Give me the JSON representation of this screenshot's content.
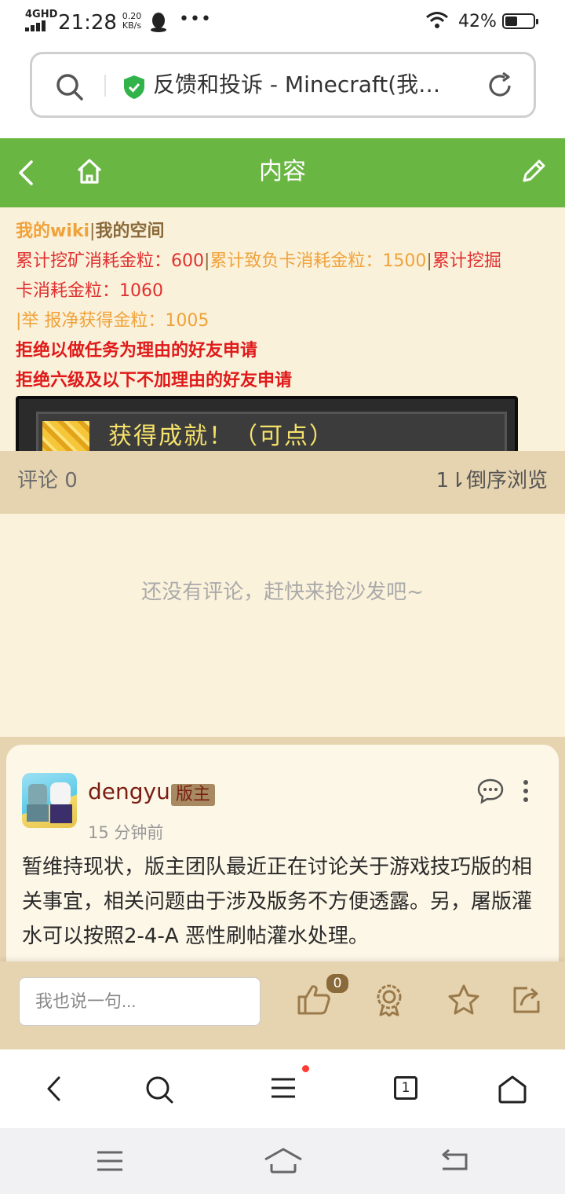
{
  "status_bar": {
    "network": "4GHD",
    "time": "21:28",
    "speed_value": "0.20",
    "speed_unit": "KB/s",
    "battery": "42%"
  },
  "url_bar": {
    "title": "反馈和投诉 - Minecraft(我…"
  },
  "header": {
    "title": "内容"
  },
  "content": {
    "line1_wiki": "我的wiki",
    "line1_sep": "|",
    "line1_space": "我的空间",
    "line2_a": "累计挖矿消耗金粒：600",
    "line2_sep1": "|",
    "line2_b": "累计致负卡消耗金粒：1500",
    "line2_sep2": "|",
    "line2_c": "累计挖掘",
    "line3": "卡消耗金粒：1060",
    "line4": "|举 报净获得金粒：1005",
    "line5": "拒绝以做任务为理由的好友申请",
    "line6": "拒绝六级及以下不加理由的好友申请",
    "achievement": "获得成就！（可点）"
  },
  "comments_header": {
    "count_label": "评论 0",
    "sort_label": "1⇂倒序浏览"
  },
  "empty_message": "还没有评论，赶快来抢沙发吧~",
  "post": {
    "username": "dengyu",
    "badge": "版主",
    "time": "15 分钟前",
    "body": "暂维持现状，版主团队最近正在讨论关于游戏技巧版的相关事宜，相关问题由于涉及版务不方便透露。另，屠版灌水可以按照2-4-A 恶性刷帖灌水处理。"
  },
  "action_bar": {
    "placeholder": "我也说一句...",
    "like_count": "0"
  },
  "browser_nav": {
    "tab_count": "1"
  },
  "colors": {
    "header_green": "#6ab643",
    "content_bg": "#faf1da",
    "tan": "#e6d3b0",
    "badge_bg": "#a78a62"
  }
}
